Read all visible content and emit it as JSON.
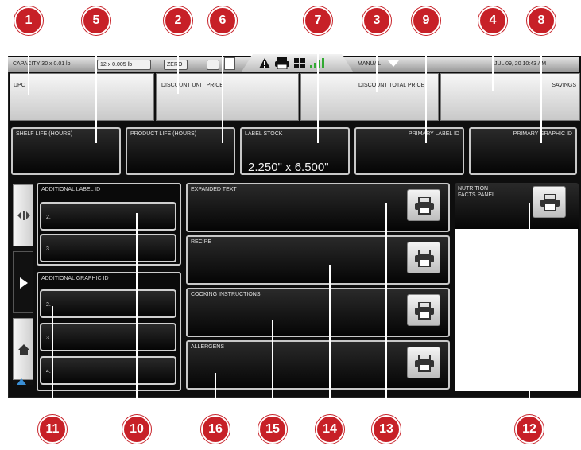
{
  "topbar": {
    "capacity": "CAPACITY   30 x 0.01 lb",
    "capacity2": "12 x 0.005 lb",
    "zero": "ZERO",
    "manual": "MANUAL",
    "datetime": "JUL 09, 20   10:43 AM"
  },
  "price_fields": {
    "upc": "UPC",
    "discount_unit_price": "DISCOUNT UNIT PRICE",
    "discount_total_price": "DISCOUNT TOTAL PRICE",
    "savings": "SAVINGS"
  },
  "info_fields": {
    "shelf_life": "SHELF LIFE (HOURS)",
    "product_life": "PRODUCT LIFE (HOURS)",
    "label_stock": "LABEL STOCK",
    "label_stock_value": "2.250\" x 6.500\"",
    "primary_label_id": "PRIMARY LABEL ID",
    "primary_graphic_id": "PRIMARY GRAPHIC ID"
  },
  "lists": {
    "additional_label_id": "ADDITIONAL LABEL ID",
    "label_items": [
      "2.",
      "3."
    ],
    "additional_graphic_id": "ADDITIONAL GRAPHIC ID",
    "graphic_items": [
      "2.",
      "3.",
      "4."
    ]
  },
  "text_fields": {
    "expanded_text": "EXPANDED TEXT",
    "recipe": "RECIPE",
    "cooking_instructions": "COOKING INSTRUCTIONS",
    "allergens": "ALLERGENS",
    "nutrition_facts": "NUTRITION FACTS PANEL"
  },
  "callouts": [
    "1",
    "2",
    "3",
    "4",
    "5",
    "6",
    "7",
    "8",
    "9",
    "10",
    "11",
    "12",
    "13",
    "14",
    "15",
    "16"
  ],
  "colors": {
    "callout": "#c72027",
    "screen": "#0e0e0e"
  },
  "icons": [
    "warning-icon",
    "printer-icon",
    "grid-icon",
    "signal-icon",
    "dropdown-arrow-icon",
    "scroll-icon",
    "play-icon",
    "home-icon"
  ]
}
